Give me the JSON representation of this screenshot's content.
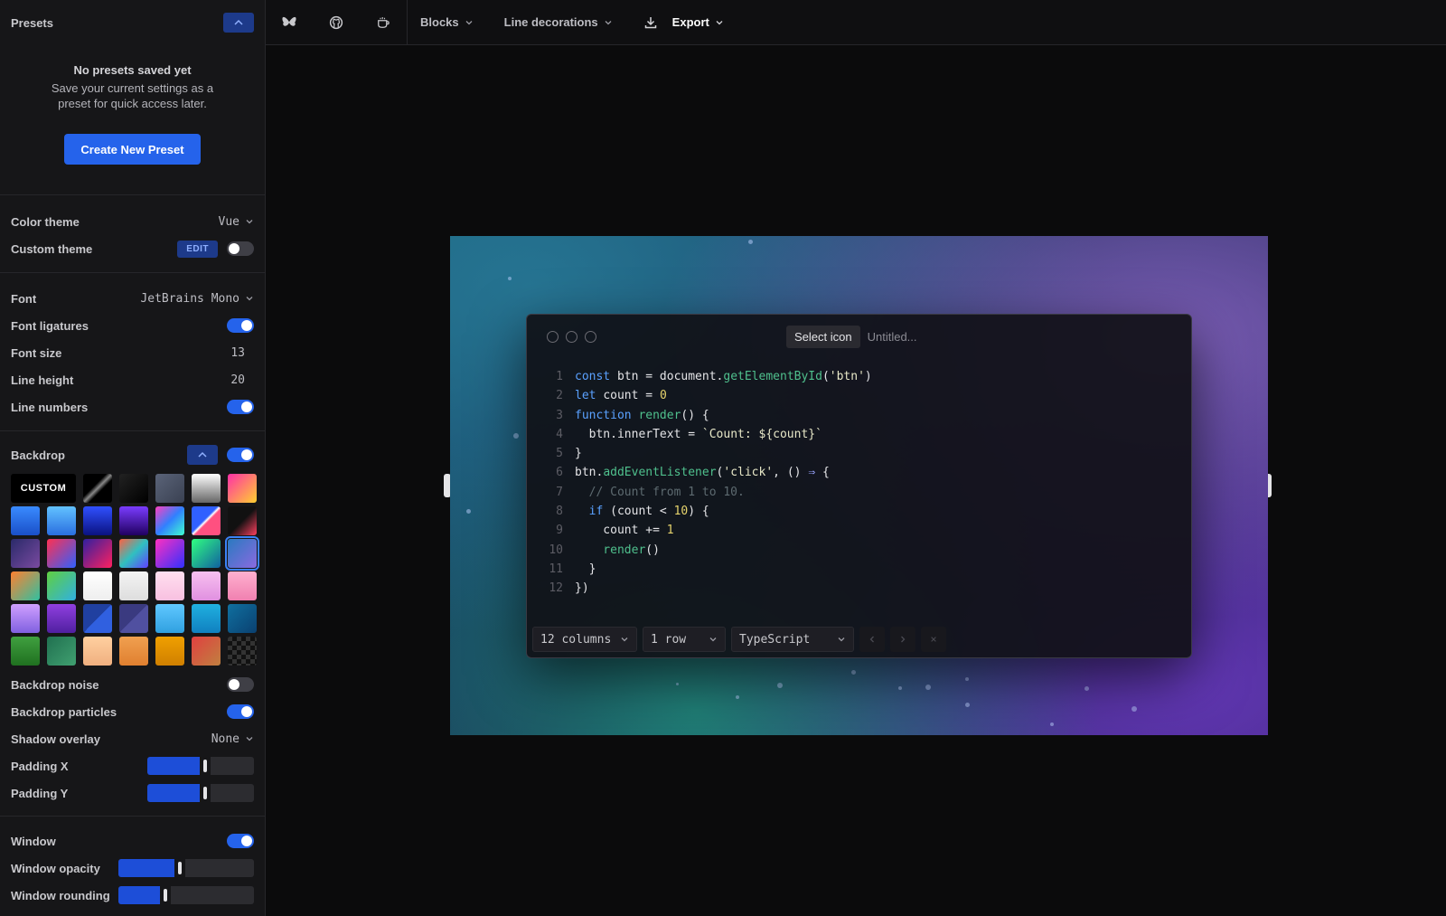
{
  "presets": {
    "title": "Presets",
    "empty_title": "No presets saved yet",
    "empty_desc": "Save your current settings as a preset for quick access later.",
    "create_button": "Create New Preset"
  },
  "theme": {
    "color_theme_label": "Color theme",
    "color_theme_value": "Vue",
    "custom_theme_label": "Custom theme",
    "edit_label": "EDIT",
    "custom_theme_on": false
  },
  "font": {
    "font_label": "Font",
    "font_value": "JetBrains Mono",
    "ligatures_label": "Font ligatures",
    "ligatures_on": true,
    "size_label": "Font size",
    "size_value": "13",
    "line_height_label": "Line height",
    "line_height_value": "20",
    "line_numbers_label": "Line numbers",
    "line_numbers_on": true
  },
  "backdrop": {
    "label": "Backdrop",
    "enabled": true,
    "custom_label": "CUSTOM",
    "noise_label": "Backdrop noise",
    "noise_on": false,
    "particles_label": "Backdrop particles",
    "particles_on": true,
    "shadow_label": "Shadow overlay",
    "shadow_value": "None",
    "padding_x_label": "Padding X",
    "padding_x_level": 0.55,
    "padding_y_label": "Padding Y",
    "padding_y_level": 0.55
  },
  "window": {
    "label": "Window",
    "enabled": true,
    "opacity_label": "Window opacity",
    "opacity_level": 0.45,
    "rounding_label": "Window rounding",
    "rounding_level": 0.33
  },
  "topbar": {
    "blocks": "Blocks",
    "line_decorations": "Line decorations",
    "export": "Export"
  },
  "editor": {
    "select_icon": "Select icon",
    "title_placeholder": "Untitled...",
    "columns": "12 columns",
    "rows": "1 row",
    "language": "TypeScript",
    "lines": [
      [
        [
          "kw",
          "const "
        ],
        [
          "plain",
          "btn = document."
        ],
        [
          "fn",
          "getElementById"
        ],
        [
          "plain",
          "("
        ],
        [
          "str",
          "'btn'"
        ],
        [
          "plain",
          ")"
        ]
      ],
      [
        [
          "kw",
          "let "
        ],
        [
          "plain",
          "count = "
        ],
        [
          "num",
          "0"
        ]
      ],
      [
        [
          "kw",
          "function "
        ],
        [
          "fn",
          "render"
        ],
        [
          "plain",
          "() {"
        ]
      ],
      [
        [
          "plain",
          "  btn.innerText = "
        ],
        [
          "str",
          "`Count: ${count}`"
        ]
      ],
      [
        [
          "plain",
          "}"
        ]
      ],
      [
        [
          "plain",
          "btn."
        ],
        [
          "fn",
          "addEventListener"
        ],
        [
          "plain",
          "("
        ],
        [
          "str",
          "'click'"
        ],
        [
          "plain",
          ", () "
        ],
        [
          "op",
          "⇒"
        ],
        [
          "plain",
          " {"
        ]
      ],
      [
        [
          "cmt",
          "  // Count from 1 to 10."
        ]
      ],
      [
        [
          "kw",
          "  if "
        ],
        [
          "plain",
          "(count < "
        ],
        [
          "num",
          "10"
        ],
        [
          "plain",
          ") {"
        ]
      ],
      [
        [
          "plain",
          "    count += "
        ],
        [
          "num",
          "1"
        ]
      ],
      [
        [
          "fn",
          "    render"
        ],
        [
          "plain",
          "()"
        ]
      ],
      [
        [
          "plain",
          "  }"
        ]
      ],
      [
        [
          "plain",
          "})"
        ]
      ]
    ]
  },
  "swatches": [
    "linear-gradient(135deg,#000 40%,#888 50%,#000 60%)",
    "linear-gradient(135deg,#222,#000)",
    "linear-gradient(135deg,#5a6378,#3a4152)",
    "linear-gradient(180deg,#fff,#666)",
    "linear-gradient(135deg,#ff2fa8,#ffcf30)",
    "linear-gradient(180deg,#3a8bff,#1a4fc8)",
    "linear-gradient(180deg,#62c2ff,#2a6ee0)",
    "linear-gradient(180deg,#3050ff,#0a1280)",
    "linear-gradient(180deg,#7a3cff,#200060)",
    "linear-gradient(135deg,#ff40c0,#3080ff,#40ffd0)",
    "linear-gradient(135deg,#3060ff 45%,#fff 50%,#ff5080 55%)",
    "linear-gradient(135deg,#111 50%,#ff4060 100%)",
    "linear-gradient(135deg,#2a2a6a,#7a4aa0)",
    "linear-gradient(135deg,#ff3050,#3060ff)",
    "linear-gradient(135deg,#3020a0,#ff2060)",
    "linear-gradient(135deg,#ff6040,#30c0c0,#6040ff)",
    "linear-gradient(135deg,#ff30c0,#3030ff)",
    "linear-gradient(135deg,#30ff80,#1060a0)",
    "linear-gradient(135deg,#2a7ac0,#8a6ae0)",
    "linear-gradient(135deg,#ff8030,#30c0a0)",
    "linear-gradient(135deg,#60d040,#30b0e0)",
    "linear-gradient(180deg,#fff,#eee)",
    "linear-gradient(180deg,#f4f4f4,#ddd)",
    "linear-gradient(180deg,#ffe0f0,#f8c0e0)",
    "linear-gradient(180deg,#f8c0f0,#e090e0)",
    "linear-gradient(180deg,#ffb0d0,#f080b0)",
    "linear-gradient(180deg,#d0a0ff,#8060e0)",
    "linear-gradient(180deg,#9040e0,#5020a0)",
    "linear-gradient(135deg,#2040a0 50%,#3060e0 50%)",
    "linear-gradient(135deg,#3a3a80 50%,#5050a0 50%)",
    "linear-gradient(180deg,#60c8ff,#30a0e0)",
    "linear-gradient(180deg,#20b0e0,#1080c0)",
    "linear-gradient(135deg,#1070a0,#0a4070)",
    "linear-gradient(180deg,#40a040,#207020)",
    "linear-gradient(135deg,#207050,#40a070)",
    "linear-gradient(180deg,#ffd0a0,#f0b080)",
    "linear-gradient(180deg,#f0a050,#e08030)",
    "linear-gradient(180deg,#f0a000,#d08000)",
    "linear-gradient(135deg,#e04040,#c08040)",
    "repeating-conic-gradient(#111 0% 25%,#333 0% 50%) 0 0/10px 10px"
  ],
  "selected_swatch": 18,
  "colors": {
    "accent": "#2563eb",
    "accent_dark": "#1d3a8a"
  },
  "icons": {
    "butterfly": "butterfly-icon",
    "github": "github-icon",
    "coffee": "coffee-icon",
    "download": "download-icon"
  }
}
